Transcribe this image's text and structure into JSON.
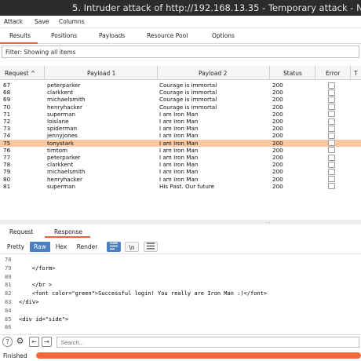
{
  "window": {
    "title": "5. Intruder attack of http://192.168.13.35 - Temporary attack - N"
  },
  "menu": [
    "Attack",
    "Save",
    "Columns"
  ],
  "tabs": [
    "Results",
    "Positions",
    "Payloads",
    "Resource Pool",
    "Options"
  ],
  "active_tab": "Results",
  "filter": {
    "text": "Filter: Showing all items"
  },
  "table": {
    "columns": [
      "Request",
      "Payload 1",
      "Payload 2",
      "Status",
      "Error",
      "T"
    ],
    "sort_indicator": "^",
    "rows": [
      {
        "request": "67",
        "p1": "peterparker",
        "p2": "Courage is immortal",
        "status": "200"
      },
      {
        "request": "68",
        "p1": "clarkkent",
        "p2": "Courage is immortal",
        "status": "200"
      },
      {
        "request": "69",
        "p1": "michaelsmith",
        "p2": "Courage is immortal",
        "status": "200"
      },
      {
        "request": "70",
        "p1": "henryhacker",
        "p2": "Courage is immortal",
        "status": "200"
      },
      {
        "request": "71",
        "p1": "superman",
        "p2": "I am Iron Man",
        "status": "200"
      },
      {
        "request": "72",
        "p1": "loislane",
        "p2": "I am Iron Man",
        "status": "200"
      },
      {
        "request": "73",
        "p1": "spiderman",
        "p2": "I am Iron Man",
        "status": "200"
      },
      {
        "request": "74",
        "p1": "jennyjones",
        "p2": "I am Iron Man",
        "status": "200"
      },
      {
        "request": "75",
        "p1": "tonystark",
        "p2": "I am Iron Man",
        "status": "200"
      },
      {
        "request": "76",
        "p1": "timtom",
        "p2": "I am Iron Man",
        "status": "200"
      },
      {
        "request": "77",
        "p1": "peterparker",
        "p2": "I am Iron Man",
        "status": "200"
      },
      {
        "request": "78",
        "p1": "clarkkent",
        "p2": "I am Iron Man",
        "status": "200"
      },
      {
        "request": "79",
        "p1": "michaelsmith",
        "p2": "I am Iron Man",
        "status": "200"
      },
      {
        "request": "80",
        "p1": "henryhacker",
        "p2": "I am Iron Man",
        "status": "200"
      },
      {
        "request": "81",
        "p1": "superman",
        "p2": "His Past. Our future",
        "status": "200"
      }
    ],
    "selected_request": "75"
  },
  "splitter_grip": "...",
  "detail_tabs": [
    "Request",
    "Response"
  ],
  "active_detail_tab": "Response",
  "viewer_toolbar": [
    "Pretty",
    "Raw",
    "Hex",
    "Render"
  ],
  "active_view": "Raw",
  "newline_toggle": "\\n",
  "code_lines": [
    {
      "n": "78",
      "text": ""
    },
    {
      "n": "79",
      "text": "    </form>"
    },
    {
      "n": "80",
      "text": ""
    },
    {
      "n": "81",
      "text": "    </br >"
    },
    {
      "n": "82",
      "text": "    <font color=\"green\">Successful login! You really are Iron Man :)</font>"
    },
    {
      "n": "83",
      "text": "</div>"
    },
    {
      "n": "84",
      "text": ""
    },
    {
      "n": "85",
      "text": "<div id=\"side\">"
    },
    {
      "n": "86",
      "text": ""
    }
  ],
  "search": {
    "placeholder": "Search..."
  },
  "status": {
    "text": "Finished",
    "progress_percent": 100
  },
  "colors": {
    "accent": "#e8643a",
    "selected_row": "#f8c9a2",
    "raw_button": "#4a7fc1",
    "progress": "#f26a35"
  },
  "icons": [
    "help-icon",
    "settings-icon",
    "back-arrow-icon",
    "forward-arrow-icon",
    "wrap-lines-icon",
    "menu-icon"
  ]
}
